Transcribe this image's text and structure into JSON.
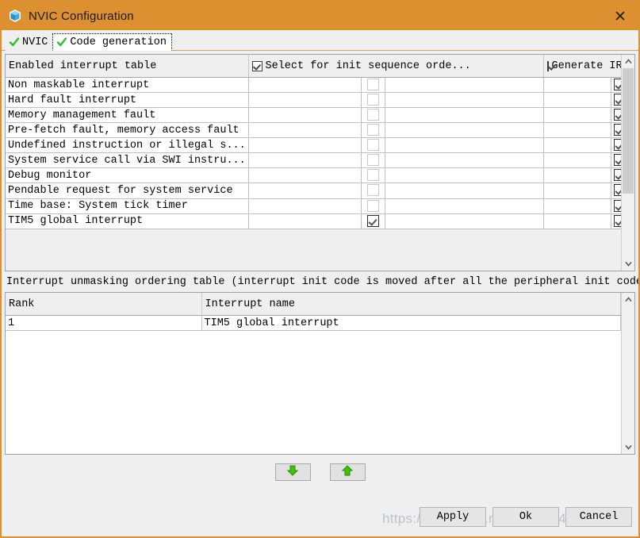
{
  "window": {
    "title": "NVIC Configuration",
    "icon": "cube-icon",
    "close_label": "✕",
    "border_color": "#dd9030",
    "titlebar_color": "#dd9030"
  },
  "tabs": [
    {
      "label": "NVIC",
      "icon": "green-check-icon",
      "active": false
    },
    {
      "label": "Code generation",
      "icon": "green-check-icon",
      "active": true
    }
  ],
  "enabled_table": {
    "columns": [
      {
        "key": "name",
        "label": "Enabled interrupt table",
        "has_checkbox": false
      },
      {
        "key": "init",
        "label": "Select for init sequence orde...",
        "has_checkbox": true,
        "checked": true
      },
      {
        "key": "irq",
        "label": "Generate IRQ han...",
        "has_checkbox": true,
        "checked": true
      }
    ],
    "rows": [
      {
        "name": "Non maskable interrupt",
        "init": false,
        "irq": true
      },
      {
        "name": "Hard fault interrupt",
        "init": false,
        "irq": true
      },
      {
        "name": "Memory management fault",
        "init": false,
        "irq": true
      },
      {
        "name": "Pre-fetch fault, memory access fault",
        "init": false,
        "irq": true
      },
      {
        "name": "Undefined instruction or illegal s...",
        "init": false,
        "irq": true
      },
      {
        "name": "System service call via SWI instru...",
        "init": false,
        "irq": true
      },
      {
        "name": "Debug monitor",
        "init": false,
        "irq": true
      },
      {
        "name": "Pendable request for system service",
        "init": false,
        "irq": true
      },
      {
        "name": "Time base: System tick timer",
        "init": false,
        "irq": true
      },
      {
        "name": "TIM5 global interrupt",
        "init": true,
        "irq": true
      }
    ]
  },
  "ordering": {
    "label": "Interrupt unmasking ordering table (interrupt init code is moved after all the peripheral init code)",
    "columns": [
      "Rank",
      "Interrupt name"
    ],
    "rows": [
      {
        "rank": "1",
        "name": "TIM5 global interrupt"
      }
    ]
  },
  "arrow_buttons": [
    {
      "name": "move-down-button",
      "direction": "down",
      "color": "#3fc20a"
    },
    {
      "name": "move-up-button",
      "direction": "up",
      "color": "#3fc20a"
    }
  ],
  "dialog_buttons": [
    {
      "label": "Apply"
    },
    {
      "label": "Ok"
    },
    {
      "label": "Cancel"
    }
  ],
  "watermark": "https://blog.csdn.net/weixin_41738734"
}
